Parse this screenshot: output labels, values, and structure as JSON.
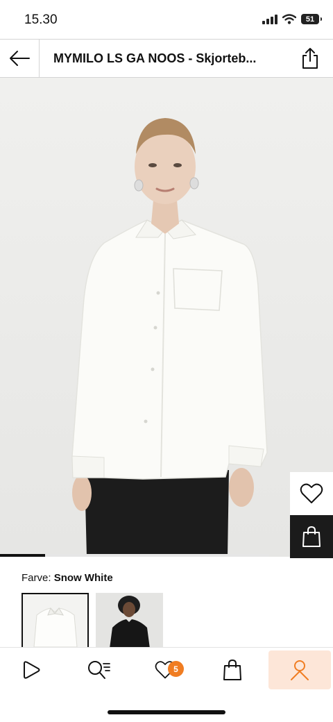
{
  "status_bar": {
    "time": "15.30",
    "battery": "51"
  },
  "header": {
    "title": "MYMILO LS GA NOOS - Skjorteb..."
  },
  "gallery": {
    "progress": 0.135
  },
  "color": {
    "label": "Farve:",
    "value": "Snow White"
  },
  "wishlist": {
    "badge_count": "5"
  },
  "colors": {
    "accent": "#f07d22",
    "active_nav_bg": "#fde6d8"
  }
}
